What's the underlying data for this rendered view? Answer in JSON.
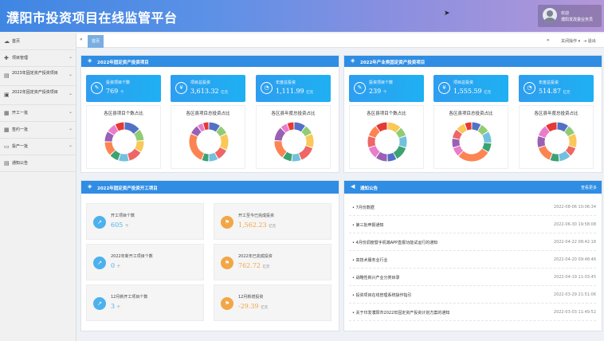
{
  "app": {
    "title": "濮阳市投资项目在线监管平台"
  },
  "user": {
    "greeting": "欢迎",
    "name": "濮阳发改委业务员"
  },
  "sidebar": {
    "items": [
      {
        "label": "首页",
        "icon": "cloud-icon",
        "arrow": ""
      },
      {
        "label": "项目管理",
        "icon": "plus-icon",
        "arrow": "⌄"
      },
      {
        "label": "2023年固定资产投资项目",
        "icon": "doc-icon",
        "arrow": "⌄"
      },
      {
        "label": "2022年固定资产投资项目",
        "icon": "briefcase-icon",
        "arrow": "⌄"
      },
      {
        "label": "开工一批",
        "icon": "grid-icon",
        "arrow": "⌄"
      },
      {
        "label": "签约一批",
        "icon": "grid-icon",
        "arrow": "⌄"
      },
      {
        "label": "投产一批",
        "icon": "folder-icon",
        "arrow": "⌄"
      },
      {
        "label": "通知公告",
        "icon": "doc-icon",
        "arrow": ""
      }
    ]
  },
  "tabs": {
    "home": "首页",
    "close_ops": "关闭操作 ▾",
    "exit": "退出"
  },
  "panel_fixed": {
    "title": "2022年固定资产投资项目",
    "stats": [
      {
        "label": "投资项目个数",
        "value": "769",
        "unit": "个"
      },
      {
        "label": "项目总投资",
        "value": "3,613.32",
        "unit": "亿元"
      },
      {
        "label": "年度总投资",
        "value": "1,111.99",
        "unit": "亿元"
      }
    ],
    "charts": [
      {
        "title": "各区县项目个数占比",
        "colors": [
          "#5470c6",
          "#91cc75",
          "#fac858",
          "#ee6666",
          "#73c0de",
          "#3ba272",
          "#fc8452",
          "#9a60b4",
          "#ea7ccc",
          "#e53935"
        ],
        "values": [
          14,
          10,
          10,
          12,
          9,
          8,
          12,
          9,
          8,
          8
        ]
      },
      {
        "title": "各区县项目总投资占比",
        "colors": [
          "#5470c6",
          "#91cc75",
          "#fac858",
          "#ee6666",
          "#73c0de",
          "#3ba272",
          "#fc8452",
          "#9a60b4",
          "#ea7ccc",
          "#e53935"
        ],
        "values": [
          10,
          8,
          14,
          10,
          8,
          6,
          26,
          8,
          5,
          5
        ]
      },
      {
        "title": "各区县年度总投资占比",
        "colors": [
          "#5470c6",
          "#91cc75",
          "#fac858",
          "#ee6666",
          "#73c0de",
          "#3ba272",
          "#fc8452",
          "#9a60b4",
          "#ea7ccc",
          "#e53935"
        ],
        "values": [
          10,
          8,
          12,
          14,
          8,
          8,
          16,
          12,
          6,
          6
        ]
      }
    ]
  },
  "panel_industry": {
    "title": "2022年产业类固定资产投资项目",
    "stats": [
      {
        "label": "投资项目个数",
        "value": "239",
        "unit": "个"
      },
      {
        "label": "项目总投资",
        "value": "1,555.59",
        "unit": "亿元"
      },
      {
        "label": "年度总投资",
        "value": "514.87",
        "unit": "亿元"
      }
    ],
    "charts": [
      {
        "title": "各区县项目个数占比",
        "colors": [
          "#fac858",
          "#91cc75",
          "#73c0de",
          "#3ba272",
          "#5470c6",
          "#9a60b4",
          "#ea7ccc",
          "#ee6666",
          "#fc8452",
          "#e53935"
        ],
        "values": [
          12,
          8,
          10,
          12,
          8,
          10,
          10,
          10,
          10,
          10
        ]
      },
      {
        "title": "各区县项目总投资占比",
        "colors": [
          "#5470c6",
          "#91cc75",
          "#73c0de",
          "#3ba272",
          "#fc8452",
          "#ea7ccc",
          "#9a60b4",
          "#ee6666",
          "#fac858",
          "#e53935"
        ],
        "values": [
          8,
          8,
          10,
          8,
          28,
          8,
          8,
          8,
          8,
          6
        ]
      },
      {
        "title": "各区县年度总投资占比",
        "colors": [
          "#5470c6",
          "#91cc75",
          "#fac858",
          "#ee6666",
          "#73c0de",
          "#3ba272",
          "#fc8452",
          "#9a60b4",
          "#ea7ccc",
          "#e53935"
        ],
        "values": [
          10,
          8,
          12,
          8,
          10,
          8,
          14,
          10,
          10,
          10
        ]
      }
    ]
  },
  "panel_start": {
    "title": "2022年固定资产投资开工项目",
    "cards": [
      {
        "label": "开工项目个数",
        "value": "605",
        "unit": "个",
        "tone": "blue"
      },
      {
        "label": "开工至今已完成投资",
        "value": "1,562.23",
        "unit": "亿元",
        "tone": "orange"
      },
      {
        "label": "2022年新开工项目个数",
        "value": "0",
        "unit": "个",
        "tone": "blue"
      },
      {
        "label": "2022年已完成投资",
        "value": "762.72",
        "unit": "亿元",
        "tone": "orange"
      },
      {
        "label": "12月新开工项目个数",
        "value": "3",
        "unit": "个",
        "tone": "blue"
      },
      {
        "label": "12月新增投资",
        "value": "-29.39",
        "unit": "亿元",
        "tone": "orange"
      }
    ]
  },
  "panel_notice": {
    "title": "通知公告",
    "more": "查看更多",
    "items": [
      {
        "title": "• 7月份数据",
        "date": "2022-08-06 10:06:34"
      },
      {
        "title": "• 第三批申报通知",
        "date": "2022-06-30 19:58:08"
      },
      {
        "title": "• 4月份调度暨手机端APP直报功能试运行的通知",
        "date": "2022-04-22 08:42:18"
      },
      {
        "title": "• 高技术服务业行业",
        "date": "2022-04-20 09:48:46"
      },
      {
        "title": "• 战略性新兴产业分类目录",
        "date": "2022-04-19 11:03:45"
      },
      {
        "title": "• 投资项目在线管理系统操作指引",
        "date": "2022-03-29 21:51:06"
      },
      {
        "title": "• 关于印发濮阳市2022年固定资产投资计划方案的通知",
        "date": "2022-03-03 11:49:52"
      }
    ]
  }
}
